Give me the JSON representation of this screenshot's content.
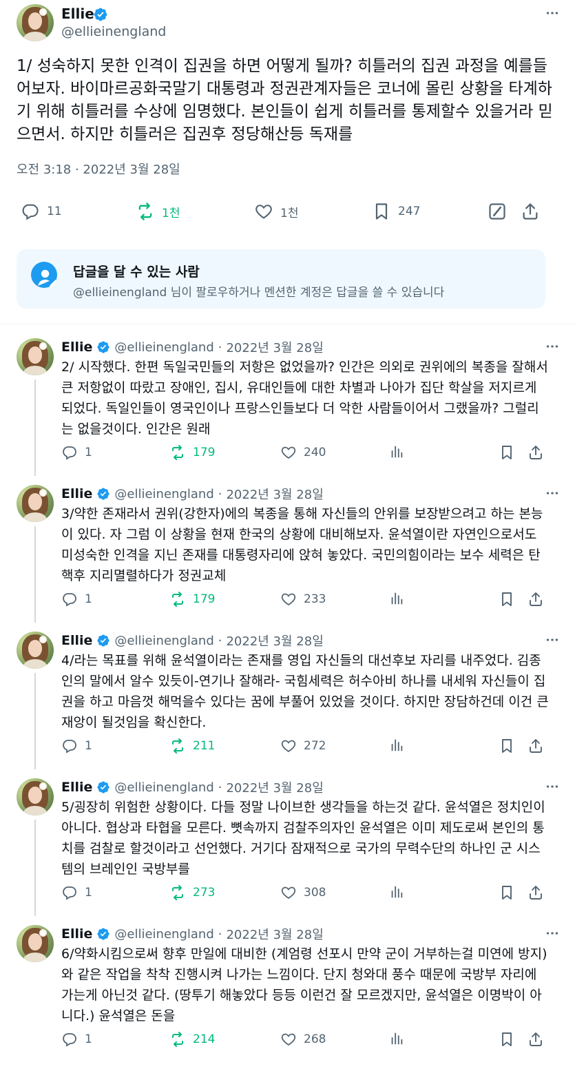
{
  "main_tweet": {
    "author": {
      "name": "Ellie",
      "handle": "@ellieinengland"
    },
    "text": "1/ 성숙하지 못한 인격이 집권을 하면 어떻게 될까? 히틀러의 집권 과정을 예를들어보자. 바이마르공화국말기 대통령과 정권관계자들은 코너에 몰린 상황을 타계하기 위해 히틀러를 수상에 임명했다. 본인들이 쉽게 히틀러를 통제할수 있을거라 믿으면서. 하지만 히틀러은 집권후 정당해산등 독재를",
    "timestamp": "오전 3:18 · 2022년 3월 28일",
    "stats": {
      "replies": "11",
      "retweets": "1천",
      "likes": "1천",
      "bookmarks": "247"
    }
  },
  "reply_permission": {
    "title": "답글을 달 수 있는 사람",
    "description": "@ellieinengland 님이 팔로우하거나 멘션한 계정은 답글을 쓸 수 있습니다"
  },
  "replies": [
    {
      "name": "Ellie",
      "handle": "@ellieinengland",
      "sep": "·",
      "date": "2022년 3월 28일",
      "text": "2/ 시작했다. 한편 독일국민들의 저항은 없었을까? 인간은 의외로 권위에의 복종을 잘해서 큰 저항없이 따랐고 장애인, 집시, 유대인들에 대한 차별과 나아가 집단 학살을 저지르게 되었다. 독일인들이 영국인이나 프랑스인들보다 더 악한 사람들이어서 그랬을까? 그럴리는 없을것이다. 인간은 원래",
      "replies": "1",
      "retweets": "179",
      "likes": "240"
    },
    {
      "name": "Ellie",
      "handle": "@ellieinengland",
      "sep": "·",
      "date": "2022년 3월 28일",
      "text": "3/약한 존재라서 권위(강한자)에의 복종을 통해 자신들의 안위를 보장받으려고 하는 본능이 있다. 자 그럼 이 상황을 현재 한국의 상황에 대비해보자. 윤석열이란 자연인으로서도 미성숙한 인격을 지닌 존재를 대통령자리에 앉혀 놓았다. 국민의힘이라는 보수 세력은 탄핵후 지리멸렬하다가 정권교체",
      "replies": "1",
      "retweets": "179",
      "likes": "233"
    },
    {
      "name": "Ellie",
      "handle": "@ellieinengland",
      "sep": "·",
      "date": "2022년 3월 28일",
      "text": "4/라는 목표를 위해 윤석열이라는 존재를 영입 자신들의 대선후보 자리를 내주었다. 김종인의 말에서 알수 있듯이-연기나 잘해라- 국힘세력은 허수아비 하나를 내세워 자신들이 집권을 하고 마음껏 해먹을수 있다는 꿈에 부풀어 있었을 것이다. 하지만 장담하건데 이건 큰 재앙이 될것임을 확신한다.",
      "replies": "1",
      "retweets": "211",
      "likes": "272"
    },
    {
      "name": "Ellie",
      "handle": "@ellieinengland",
      "sep": "·",
      "date": "2022년 3월 28일",
      "text": "5/굉장히 위험한 상황이다. 다들 정말 나이브한 생각들을 하는것 같다. 윤석열은 정치인이 아니다. 협상과 타협을 모른다. 뼛속까지 검찰주의자인 윤석열은 이미 제도로써 본인의 통치를 검찰로 할것이라고 선언했다. 거기다 잠재적으로 국가의 무력수단의 하나인 군 시스템의 브레인인 국방부를",
      "replies": "1",
      "retweets": "273",
      "likes": "308"
    },
    {
      "name": "Ellie",
      "handle": "@ellieinengland",
      "sep": "·",
      "date": "2022년 3월 28일",
      "text": "6/약화시킴으로써 향후 만일에 대비한 (계엄령 선포시 만약 군이 거부하는걸 미연에 방지)와 같은 작업을 착착 진행시켜 나가는 느낌이다. 단지 청와대 풍수 때문에 국방부 자리에 가는게 아닌것 같다. (땅투기 해놓았다 등등 이런건 잘 모르겠지만, 윤석열은 이명박이 아니다.) 윤석열은 돈을",
      "replies": "1",
      "retweets": "214",
      "likes": "268"
    }
  ],
  "colors": {
    "text": "#0f1419",
    "secondary": "#536471",
    "accent": "#1d9bf0",
    "retweet": "#00ba7c",
    "reply_box_bg": "#eff8fe"
  },
  "icons": [
    "verified-badge-icon",
    "more-options-icon",
    "reply-icon",
    "retweet-icon",
    "like-icon",
    "bookmark-icon",
    "views-icon",
    "share-icon",
    "grok-icon",
    "person-mention-icon"
  ]
}
